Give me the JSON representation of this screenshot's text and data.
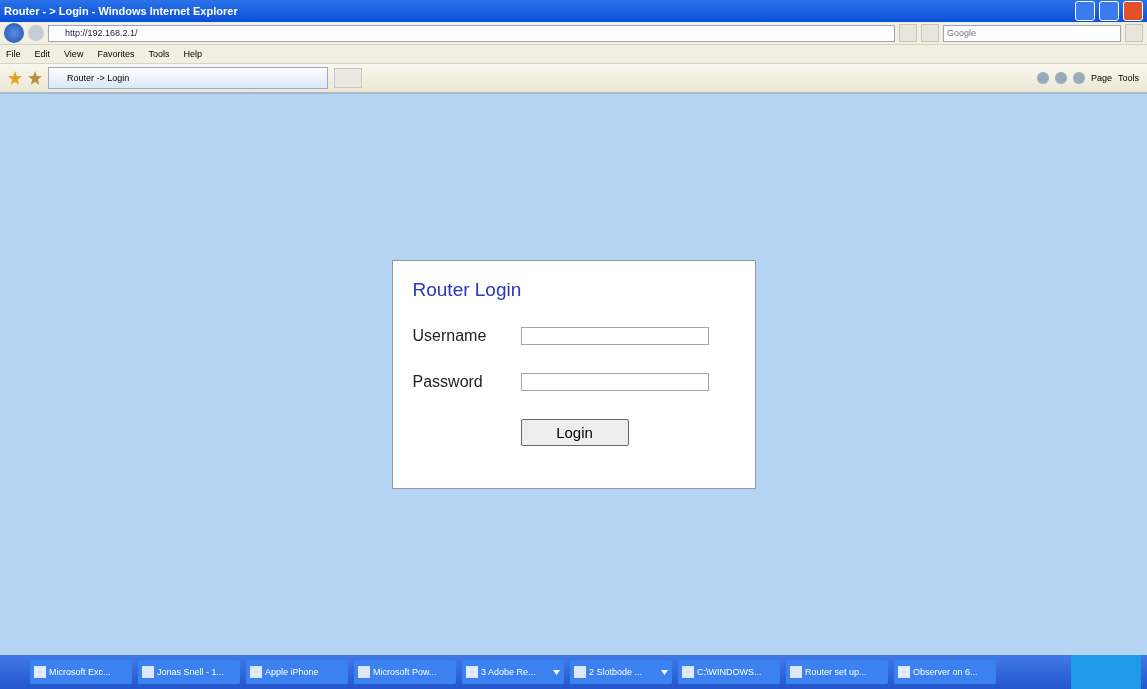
{
  "window": {
    "title": "Router - > Login - Windows Internet Explorer"
  },
  "address_bar": {
    "url": "http://192.168.2.1/"
  },
  "search": {
    "placeholder": "Google"
  },
  "menu": [
    "File",
    "Edit",
    "View",
    "Favorites",
    "Tools",
    "Help"
  ],
  "tabs": [
    {
      "label": "Router -> Login",
      "selected": true
    }
  ],
  "command_bar": [
    "Page",
    "Tools"
  ],
  "login": {
    "title": "Router Login",
    "fields": [
      {
        "label": "Username"
      },
      {
        "label": "Password"
      }
    ],
    "button": "Login"
  },
  "taskbar": [
    {
      "label": "Microsoft Exc...",
      "grouped": false
    },
    {
      "label": "Jonas Snell - 1...",
      "grouped": false
    },
    {
      "label": "Apple iPhone",
      "grouped": false
    },
    {
      "label": "Microsoft Pow...",
      "grouped": false
    },
    {
      "label": "3 Adobe Re...",
      "grouped": true
    },
    {
      "label": "2 Slotbode ...",
      "grouped": true
    },
    {
      "label": "C:\\WINDOWS...",
      "grouped": false
    },
    {
      "label": "Router set up...",
      "grouped": false
    },
    {
      "label": "Observer on 6...",
      "grouped": false
    }
  ]
}
